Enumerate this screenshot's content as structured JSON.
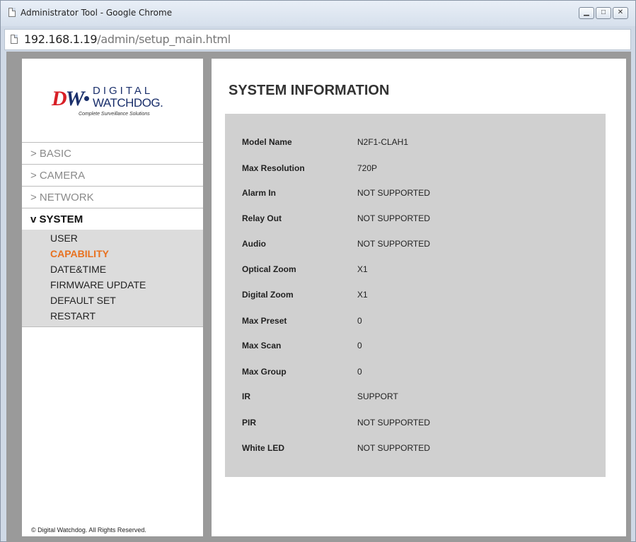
{
  "window": {
    "title": "Administrator Tool - Google Chrome",
    "url_host": "192.168.1.19",
    "url_path": "/admin/setup_main.html"
  },
  "logo": {
    "brand_dw": "DW",
    "brand_digital": "DIGITAL",
    "brand_watchdog": "WATCHDOG.",
    "tagline": "Complete Surveillance Solutions"
  },
  "sidebar": {
    "menu": [
      {
        "label": "> BASIC"
      },
      {
        "label": "> CAMERA"
      },
      {
        "label": "> NETWORK"
      },
      {
        "label": "v SYSTEM"
      }
    ],
    "submenu": [
      {
        "label": "USER"
      },
      {
        "label": "CAPABILITY"
      },
      {
        "label": "DATE&TIME"
      },
      {
        "label": "FIRMWARE UPDATE"
      },
      {
        "label": "DEFAULT SET"
      },
      {
        "label": "RESTART"
      }
    ],
    "footer": "© Digital Watchdog. All Rights Reserved."
  },
  "main": {
    "title": "SYSTEM INFORMATION",
    "rows": [
      {
        "label": "Model Name",
        "value": "N2F1-CLAH1"
      },
      {
        "label": "Max Resolution",
        "value": "720P"
      },
      {
        "label": "Alarm In",
        "value": "NOT SUPPORTED"
      },
      {
        "label": "Relay Out",
        "value": "NOT SUPPORTED"
      },
      {
        "label": "Audio",
        "value": "NOT SUPPORTED"
      },
      {
        "label": "Optical Zoom",
        "value": "X1"
      },
      {
        "label": "Digital Zoom",
        "value": "X1"
      },
      {
        "label": "Max Preset",
        "value": "0"
      },
      {
        "label": "Max Scan",
        "value": "0"
      },
      {
        "label": "Max Group",
        "value": "0"
      },
      {
        "label": "IR",
        "value": "SUPPORT"
      },
      {
        "label": "PIR",
        "value": "NOT SUPPORTED"
      },
      {
        "label": "White LED",
        "value": "NOT SUPPORTED"
      }
    ]
  },
  "colors": {
    "accent": "#e8711f",
    "brand_red": "#d81f26",
    "brand_navy": "#1a2f6b"
  }
}
